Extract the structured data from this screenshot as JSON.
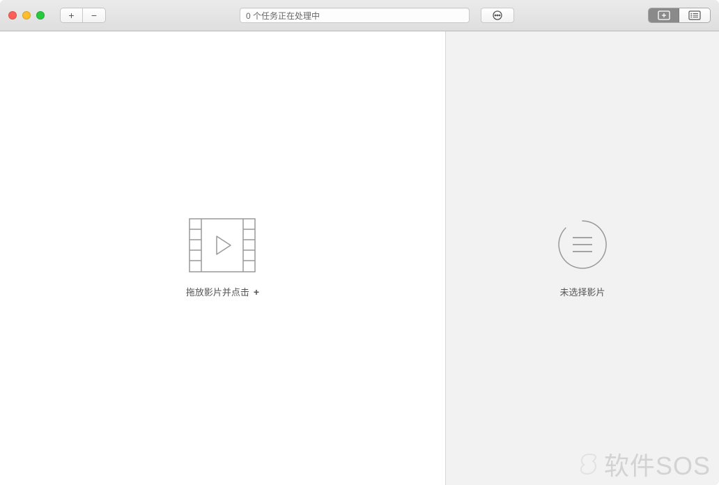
{
  "toolbar": {
    "add_label": "+",
    "remove_label": "−",
    "status_text": "0 个任务正在处理中"
  },
  "left_panel": {
    "drop_hint": "拖放影片并点击",
    "plus_symbol": "+"
  },
  "right_panel": {
    "empty_text": "未选择影片"
  },
  "watermark": {
    "text": "软件SOS"
  }
}
